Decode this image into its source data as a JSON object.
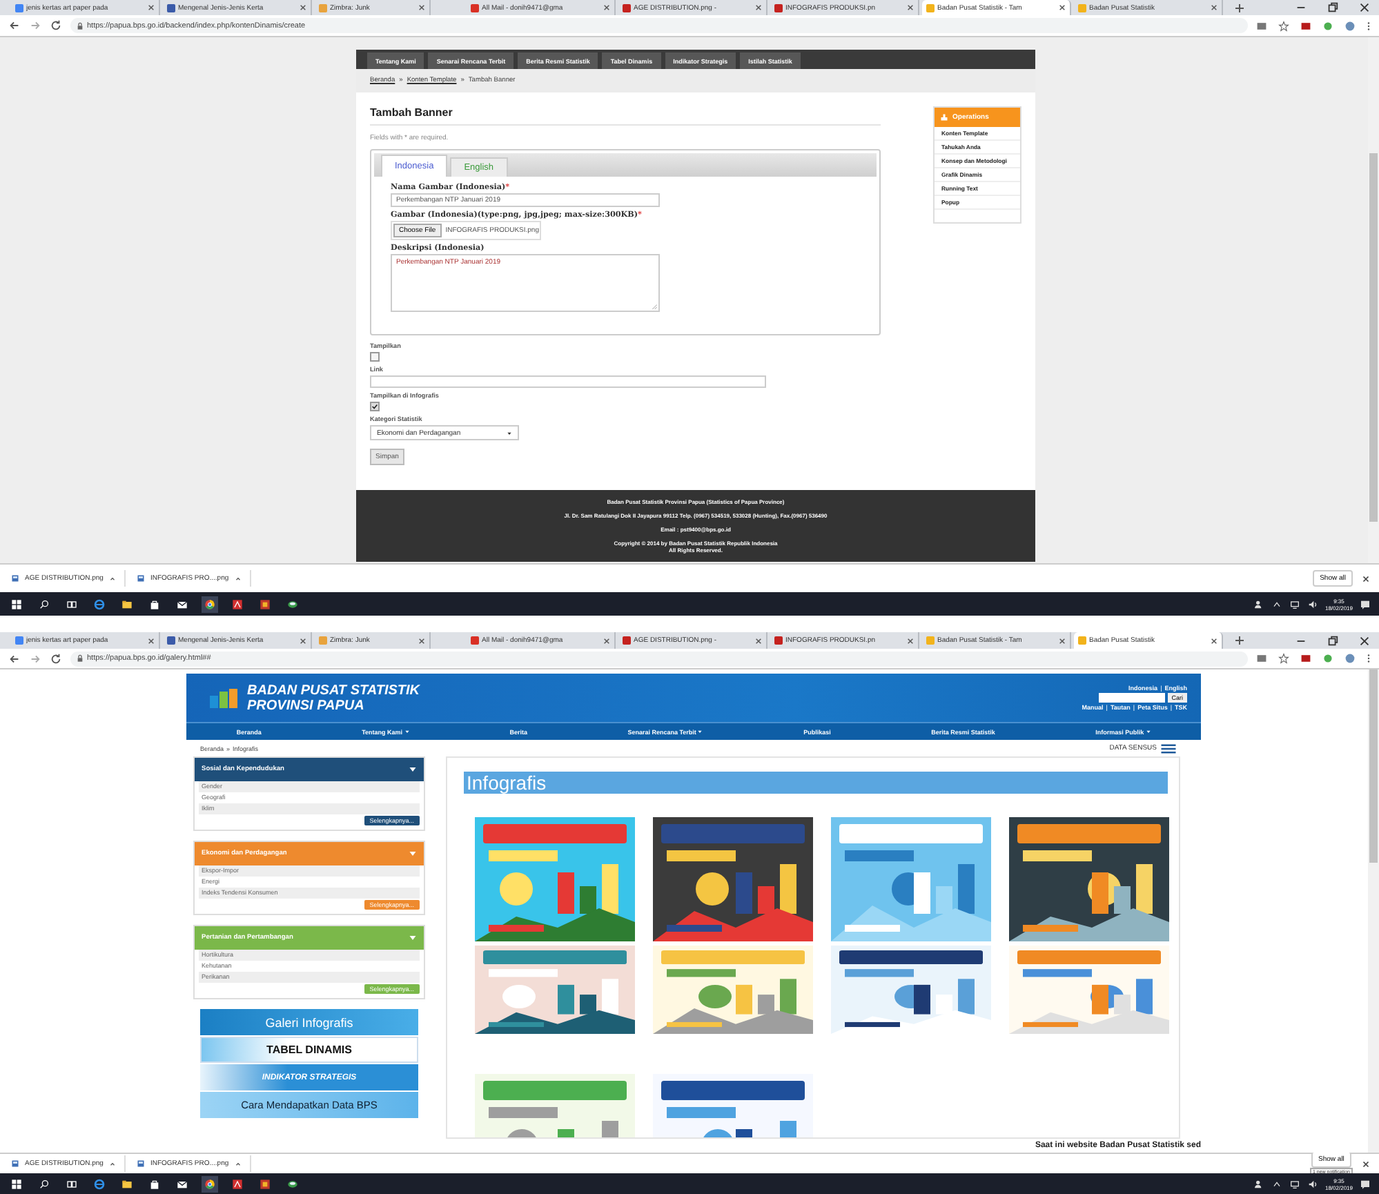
{
  "screens": [
    {
      "kind": "form",
      "tabs": [
        {
          "title": "jenis kertas art paper pada",
          "selected": false
        },
        {
          "title": "Mengenal Jenis-Jenis Kerta",
          "selected": false
        },
        {
          "title": "Zimbra: Junk",
          "selected": false
        },
        {
          "title": "All Mail - donih9471@gma",
          "selected": false
        },
        {
          "title": "AGE DISTRIBUTION.png - ",
          "selected": false
        },
        {
          "title": "INFOGRAFIS PRODUKSI.pn",
          "selected": false
        },
        {
          "title": "Badan Pusat Statistik - Tam",
          "selected": true
        },
        {
          "title": "Badan Pusat Statistik",
          "selected": false
        }
      ],
      "url": "https://papua.bps.go.id/backend/index.php/kontenDinamis/create",
      "page": {
        "nav": [
          "Tentang Kami",
          "Senarai Rencana Terbit",
          "Berita Resmi Statistik",
          "Tabel Dinamis",
          "Indikator Strategis",
          "Istilah Statistik"
        ],
        "breadcrumb": [
          {
            "label": "Beranda",
            "link": true
          },
          {
            "label": "Konten Template",
            "link": true
          },
          {
            "label": "Tambah Banner",
            "link": false
          }
        ],
        "separator": "»",
        "title": "Tambah Banner",
        "note": "Fields with * are required.",
        "lang_tabs": [
          {
            "label": "Indonesia",
            "selected": true
          },
          {
            "label": "English",
            "selected": false
          }
        ],
        "required_mark": "*",
        "fields": [
          {
            "kind": "text",
            "label": "Nama Gambar (Indonesia)",
            "required": true,
            "value": "Perkembangan NTP Januari 2019"
          },
          {
            "kind": "file",
            "label": "Gambar (Indonesia)(type:png, jpg,jpeg; max-size:300KB)",
            "required": true,
            "button": "Choose File",
            "value": "INFOGRAFIS PRODUKSI.png"
          },
          {
            "kind": "textarea",
            "label": "Deskripsi (Indonesia)",
            "required": false,
            "value": "Perkembangan NTP Januari 2019"
          }
        ],
        "options": [
          {
            "kind": "checkbox",
            "label": "Tampilkan",
            "checked": false
          },
          {
            "kind": "text",
            "label": "Link"
          },
          {
            "kind": "checkbox",
            "label": "Tampilkan di Infografis",
            "checked": true
          },
          {
            "kind": "select",
            "label": "Kategori Statistik",
            "value": "Ekonomi dan Perdagangan"
          }
        ],
        "submit": "Simpan",
        "operations": {
          "title": "Operations",
          "items": [
            "Konten Template",
            "Tahukah Anda",
            "Konsep dan Metodologi",
            "Grafik Dinamis",
            "Running Text",
            "Popup"
          ]
        },
        "footer": [
          "Badan Pusat Statistik Provinsi Papua (Statistics of Papua Province)",
          "Jl. Dr. Sam Ratulangi Dok II Jayapura 99112 Telp. (0967) 534519, 533028 (Hunting), Fax.(0967) 536490",
          "Email : pst9400@bps.go.id",
          "Copyright © 2014 by Badan Pusat Statistik Republik Indonesia",
          "All Rights Reserved."
        ]
      },
      "downloads": [
        "AGE DISTRIBUTION.png",
        "INFOGRAFIS PRO....png"
      ],
      "show_all": "Show all",
      "taskbar": {
        "time": "9:35",
        "date": "18/02/2019"
      }
    },
    {
      "kind": "gallery",
      "tabs": [
        {
          "title": "jenis kertas art paper pada",
          "selected": false
        },
        {
          "title": "Mengenal Jenis-Jenis Kerta",
          "selected": false
        },
        {
          "title": "Zimbra: Junk",
          "selected": false
        },
        {
          "title": "All Mail - donih9471@gma",
          "selected": false
        },
        {
          "title": "AGE DISTRIBUTION.png - ",
          "selected": false
        },
        {
          "title": "INFOGRAFIS PRODUKSI.pn",
          "selected": false
        },
        {
          "title": "Badan Pusat Statistik - Tam",
          "selected": false
        },
        {
          "title": "Badan Pusat Statistik",
          "selected": true
        }
      ],
      "url": "https://papua.bps.go.id/galery.html##",
      "page": {
        "logo": [
          "BADAN PUSAT STATISTIK",
          "PROVINSI PAPUA"
        ],
        "languages": [
          "Indonesia",
          "English"
        ],
        "search_button": "Cari",
        "links": [
          "Manual",
          "Tautan",
          "Peta Situs",
          "TSK"
        ],
        "links_separator": "|",
        "nav": [
          {
            "label": "Beranda",
            "has_menu": false
          },
          {
            "label": "Tentang Kami",
            "has_menu": true
          },
          {
            "label": "Berita",
            "has_menu": false
          },
          {
            "label": "Senarai Rencana Terbit",
            "has_menu": true
          },
          {
            "label": "Publikasi",
            "has_menu": false
          },
          {
            "label": "Berita Resmi Statistik",
            "has_menu": false
          },
          {
            "label": "Informasi Publik",
            "has_menu": true
          }
        ],
        "breadcrumb": [
          "Beranda",
          "Infografis"
        ],
        "separator": "»",
        "data_sensus": "DATA SENSUS",
        "categories": [
          {
            "title": "Sosial dan Kependudukan",
            "color": "#1f4f7a",
            "items": [
              "Gender",
              "Geografi",
              "Iklim"
            ],
            "more": "Selengkapnya..."
          },
          {
            "title": "Ekonomi dan Perdagangan",
            "color": "#ee8a2e",
            "items": [
              "Ekspor-Impor",
              "Energi",
              "Indeks Tendensi Konsumen"
            ],
            "more": "Selengkapnya..."
          },
          {
            "title": "Pertanian dan Pertambangan",
            "color": "#7bb84a",
            "items": [
              "Hortikultura",
              "Kehutanan",
              "Perikanan"
            ],
            "more": "Selengkapnya..."
          }
        ],
        "banners": [
          "Galeri Infografis",
          "TABEL DINAMIS",
          "INDIKATOR STRATEGIS",
          "Cara Mendapatkan Data BPS"
        ],
        "heading": "Infografis",
        "thumbnails": [
          {
            "kind": "picture"
          },
          {
            "kind": "picture"
          },
          {
            "kind": "picture"
          },
          {
            "kind": "picture"
          },
          {
            "kind": "picture"
          },
          {
            "kind": "picture"
          },
          {
            "kind": "picture"
          },
          {
            "kind": "picture"
          },
          {
            "kind": "picture"
          },
          {
            "kind": "picture"
          }
        ],
        "ticker": "Saat ini website Badan Pusat Statistik sed"
      },
      "downloads": [
        "AGE DISTRIBUTION.png",
        "INFOGRAFIS PRO....png"
      ],
      "show_all": "Show all",
      "notification": "1 new notification",
      "taskbar": {
        "time": "9:35",
        "date": "18/02/2019"
      }
    }
  ]
}
